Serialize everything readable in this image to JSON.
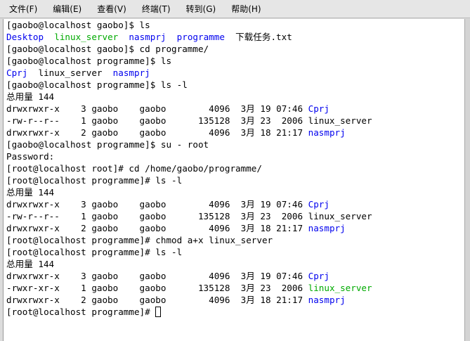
{
  "menu": [
    {
      "name": "menu-file",
      "label": "文件(F)"
    },
    {
      "name": "menu-edit",
      "label": "编辑(E)"
    },
    {
      "name": "menu-view",
      "label": "查看(V)"
    },
    {
      "name": "menu-terminal",
      "label": "终端(T)"
    },
    {
      "name": "menu-goto",
      "label": "转到(G)"
    },
    {
      "name": "menu-help",
      "label": "帮助(H)"
    }
  ],
  "colors": {
    "dir": "#0000ee",
    "exec": "#00aa00",
    "text": "#000000",
    "background": "#ffffff"
  },
  "lines": [
    [
      {
        "t": "[gaobo@localhost gaobo]$ ls"
      }
    ],
    [
      {
        "t": "Desktop",
        "c": "blue"
      },
      {
        "t": "  "
      },
      {
        "t": "linux_server",
        "c": "green"
      },
      {
        "t": "  "
      },
      {
        "t": "nasmprj",
        "c": "blue"
      },
      {
        "t": "  "
      },
      {
        "t": "programme",
        "c": "blue"
      },
      {
        "t": "  下载任务.txt"
      }
    ],
    [
      {
        "t": "[gaobo@localhost gaobo]$ cd programme/"
      }
    ],
    [
      {
        "t": "[gaobo@localhost programme]$ ls"
      }
    ],
    [
      {
        "t": "Cprj",
        "c": "blue"
      },
      {
        "t": "  linux_server  "
      },
      {
        "t": "nasmprj",
        "c": "blue"
      }
    ],
    [
      {
        "t": "[gaobo@localhost programme]$ ls -l"
      }
    ],
    [
      {
        "t": "总用量 144"
      }
    ],
    [
      {
        "t": "drwxrwxr-x    3 gaobo    gaobo        4096  3月 19 07:46 "
      },
      {
        "t": "Cprj",
        "c": "blue"
      }
    ],
    [
      {
        "t": "-rw-r--r--    1 gaobo    gaobo      135128  3月 23  2006 linux_server"
      }
    ],
    [
      {
        "t": "drwxrwxr-x    2 gaobo    gaobo        4096  3月 18 21:17 "
      },
      {
        "t": "nasmprj",
        "c": "blue"
      }
    ],
    [
      {
        "t": "[gaobo@localhost programme]$ su - root"
      }
    ],
    [
      {
        "t": "Password:"
      }
    ],
    [
      {
        "t": "[root@localhost root]# cd /home/gaobo/programme/"
      }
    ],
    [
      {
        "t": "[root@localhost programme]# ls -l"
      }
    ],
    [
      {
        "t": "总用量 144"
      }
    ],
    [
      {
        "t": "drwxrwxr-x    3 gaobo    gaobo        4096  3月 19 07:46 "
      },
      {
        "t": "Cprj",
        "c": "blue"
      }
    ],
    [
      {
        "t": "-rw-r--r--    1 gaobo    gaobo      135128  3月 23  2006 linux_server"
      }
    ],
    [
      {
        "t": "drwxrwxr-x    2 gaobo    gaobo        4096  3月 18 21:17 "
      },
      {
        "t": "nasmprj",
        "c": "blue"
      }
    ],
    [
      {
        "t": "[root@localhost programme]# chmod a+x linux_server"
      }
    ],
    [
      {
        "t": "[root@localhost programme]# ls -l"
      }
    ],
    [
      {
        "t": "总用量 144"
      }
    ],
    [
      {
        "t": "drwxrwxr-x    3 gaobo    gaobo        4096  3月 19 07:46 "
      },
      {
        "t": "Cprj",
        "c": "blue"
      }
    ],
    [
      {
        "t": "-rwxr-xr-x    1 gaobo    gaobo      135128  3月 23  2006 "
      },
      {
        "t": "linux_server",
        "c": "green"
      }
    ],
    [
      {
        "t": "drwxrwxr-x    2 gaobo    gaobo        4096  3月 18 21:17 "
      },
      {
        "t": "nasmprj",
        "c": "blue"
      }
    ],
    [
      {
        "t": "[root@localhost programme]# "
      }
    ]
  ]
}
